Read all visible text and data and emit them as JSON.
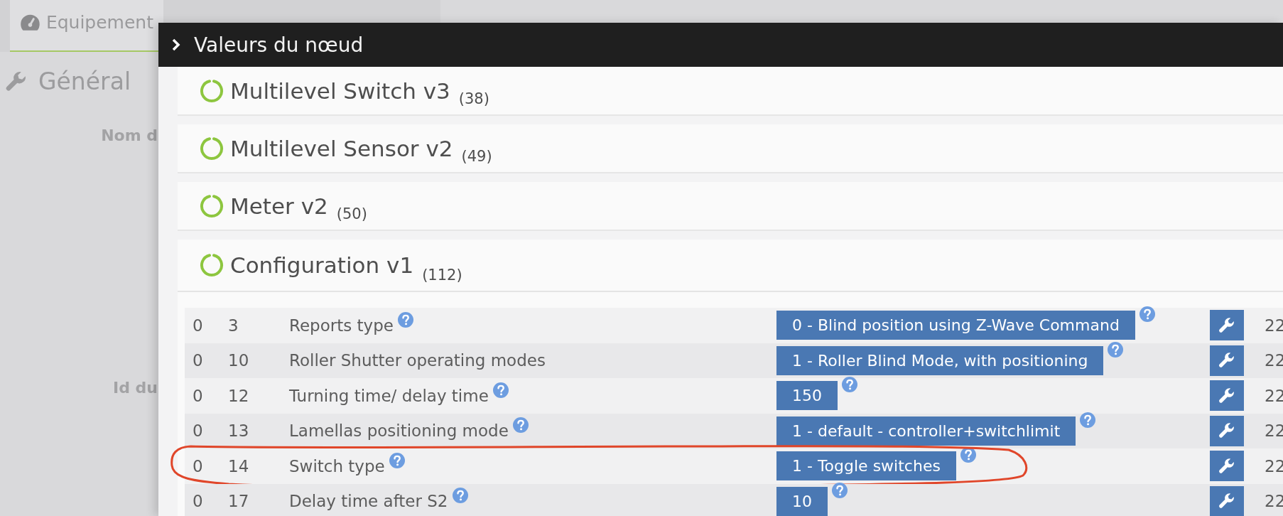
{
  "background": {
    "tabs": [
      {
        "label": "Equipement",
        "selected": true
      }
    ],
    "section_title": "Général",
    "fields": [
      {
        "label": "Nom d"
      },
      {
        "label": "Id du"
      }
    ]
  },
  "modal": {
    "title": "Valeurs du nœud",
    "panels": [
      {
        "title": "Multilevel Switch v3",
        "count": "(38)"
      },
      {
        "title": "Multilevel Sensor v2",
        "count": "(49)"
      },
      {
        "title": "Meter v2",
        "count": "(50)"
      }
    ],
    "config": {
      "title": "Configuration v1",
      "count": "(112)",
      "rows": [
        {
          "instance": "0",
          "index": "3",
          "name": "Reports type",
          "help": true,
          "value": "0 - Blind position using Z-Wave Command",
          "value_help": true,
          "column_6": "22",
          "circled": false
        },
        {
          "instance": "0",
          "index": "10",
          "name": "Roller Shutter operating modes",
          "help": false,
          "value": "1 - Roller Blind Mode, with positioning",
          "value_help": true,
          "column_6": "22",
          "circled": false
        },
        {
          "instance": "0",
          "index": "12",
          "name": "Turning time/ delay time",
          "help": true,
          "value": "150",
          "value_help": true,
          "column_6": "22",
          "circled": false
        },
        {
          "instance": "0",
          "index": "13",
          "name": "Lamellas positioning mode",
          "help": true,
          "value": "1 - default - controller+switchlimit",
          "value_help": true,
          "column_6": "22",
          "circled": false
        },
        {
          "instance": "0",
          "index": "14",
          "name": "Switch type",
          "help": true,
          "value": "1 - Toggle switches",
          "value_help": true,
          "column_6": "22",
          "circled": true
        },
        {
          "instance": "0",
          "index": "17",
          "name": "Delay time after S2",
          "help": true,
          "value": "10",
          "value_help": true,
          "column_6": "22",
          "circled": false
        }
      ]
    }
  }
}
